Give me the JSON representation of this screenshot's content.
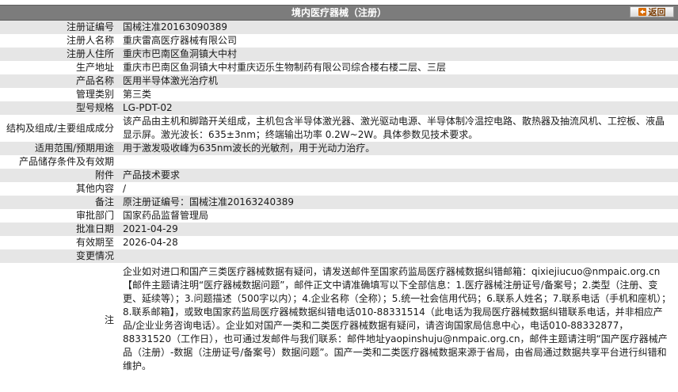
{
  "header": {
    "title": "境内医疗器械（注册）",
    "back_label": "返回"
  },
  "rows": [
    {
      "label": "注册证编号",
      "value": "国械注准20163090389"
    },
    {
      "label": "注册人名称",
      "value": "重庆雷高医疗器械有限公司"
    },
    {
      "label": "注册人住所",
      "value": "重庆市巴南区鱼洞镇大中村"
    },
    {
      "label": "生产地址",
      "value": "重庆市巴南区鱼洞镇大中村重庆迈乐生物制药有限公司综合楼右楼二层、三层"
    },
    {
      "label": "产品名称",
      "value": "医用半导体激光治疗机"
    },
    {
      "label": "管理类别",
      "value": "第三类"
    },
    {
      "label": "型号规格",
      "value": "LG-PDT-02"
    },
    {
      "label": "结构及组成/主要组成成分",
      "value": "该产品由主机和脚踏开关组成，主机包含半导体激光器、激光驱动电源、半导体制冷温控电路、散热器及抽流风机、工控板、液晶显示屏。激光波长：635±3nm；终端输出功率 0.2W~2W。具体参数见技术要求。"
    },
    {
      "label": "适用范围/预期用途",
      "value": "用于激发吸收峰为635nm波长的光敏剂，用于光动力治疗。"
    },
    {
      "label": "产品储存条件及有效期",
      "value": ""
    },
    {
      "label": "附件",
      "value": "产品技术要求"
    },
    {
      "label": "其他内容",
      "value": "/"
    },
    {
      "label": "备注",
      "value": "原注册证编号：国械注准20163240389"
    },
    {
      "label": "审批部门",
      "value": "国家药品监督管理局"
    },
    {
      "label": "批准日期",
      "value": "2021-04-29"
    },
    {
      "label": "有效期至",
      "value": "2026-04-28"
    },
    {
      "label": "变更情况",
      "value": ""
    }
  ],
  "note": {
    "label": "注",
    "text": "企业如对进口和国产三类医疗器械数据有疑问，请发送邮件至国家药监局医疗器械数据纠错邮箱：qixiejiucuo@nmpaic.org.cn【邮件主题请注明“医疗器械数据问题”，邮件正文中请准确填写以下全部信息：1.医疗器械注册证号/备案号；2.类型（注册、变更、延续等）；3.问题描述（500字以内）；4.企业名称（全称）；5.统一社会信用代码；6.联系人姓名；7.联系电话（手机和座机）；8.联系邮箱】，或致电国家药监局医疗器械数据纠错电话010-88331514（此电话为我局医疗器械数据纠错联系电话，并非相应产品/企业业务咨询电话）。企业如对国产一类和二类医疗器械数据有疑问，请咨询国家局信息中心，电话010-88332877，88331520（工作日），也可通过发邮件与我们联系：邮件地址yaopinshuju@nmpaic.org.cn，邮件主题请注明“国产医疗器械产品（注册）-数据（注册证号/备案号）数据问题”。国产一类和二类医疗器械数据来源于省局，由省局通过数据共享平台进行纠错和维护。"
  },
  "colors": {
    "header_bg": "#7c7c7c",
    "row_grey": "#e6e6e6",
    "row_white": "#ffffff",
    "back_text": "#7a3b00"
  }
}
